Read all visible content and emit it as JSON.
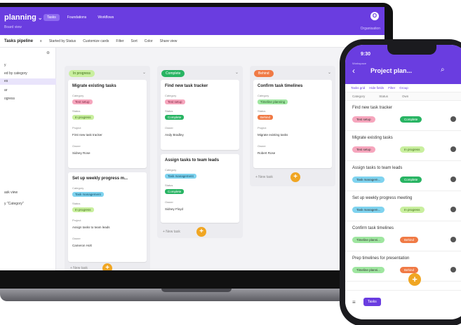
{
  "app": {
    "title": "planning",
    "title_caret": "⌄",
    "subtitle": "Board view",
    "nav": [
      "Tasks",
      "Foundations",
      "Workflows"
    ],
    "avatar_initial": "O",
    "top_right_label": "Organisation"
  },
  "toolbar": {
    "view": "Tasks pipeline",
    "items": [
      "Started by Status",
      "Customize cards",
      "Filter",
      "Sort",
      "Color",
      "Share view"
    ]
  },
  "sidebar": {
    "items": [
      "y",
      "ed by category",
      "es",
      "ar",
      "ogress",
      "ask view",
      "y \"Category\""
    ],
    "selected_index": 2
  },
  "columns": [
    {
      "status": "In progress",
      "color": "#c9ef9f",
      "text_color": "#3a6b12",
      "add_label": "+ New task",
      "cards": [
        {
          "title": "Migrate existing tasks",
          "category_label": "Category",
          "category": "Test setup",
          "status_label": "Status",
          "status": "In progress",
          "desc_label": "Project",
          "desc": "First new task tracker",
          "owner_label": "Owner",
          "owner": "Sidney Rose"
        },
        {
          "title": "Set up weekly progress m...",
          "category_label": "Category",
          "category": "Task management",
          "status_label": "Status",
          "status": "In progress",
          "desc_label": "Project",
          "desc": "Assign tasks to team leads",
          "owner_label": "Owner",
          "owner": "Cameron Holt"
        }
      ]
    },
    {
      "status": "Complete",
      "color": "#28b463",
      "text_color": "#ffffff",
      "add_label": "+ New task",
      "cards": [
        {
          "title": "Find new task tracker",
          "category_label": "Category",
          "category": "Test setup",
          "status_label": "Status",
          "status": "Complete",
          "owner_label": "Owner",
          "owner": "Andy Bradley"
        },
        {
          "title": "Assign tasks to team leads",
          "category_label": "Category",
          "category": "Task management",
          "status_label": "Status",
          "status": "Complete",
          "owner_label": "Owner",
          "owner": "Sidney Floyd"
        }
      ]
    },
    {
      "status": "Behind",
      "color": "#f07a45",
      "text_color": "#ffffff",
      "add_label": "+ New task",
      "cards": [
        {
          "title": "Confirm task timelines",
          "category_label": "Category",
          "category": "Timeline planning",
          "status_label": "Status",
          "status": "Behind",
          "desc_label": "Project",
          "desc": "Migrate existing tasks",
          "owner_label": "Owner",
          "owner": "Robert Rose"
        }
      ]
    }
  ],
  "phone": {
    "time": "9:30",
    "subtitle": "Workspace",
    "title": "Project plan...",
    "toolbar": [
      "Tasks grid",
      "Hide fields",
      "Filter",
      "Group"
    ],
    "columns": [
      "Category",
      "Status",
      "Own"
    ],
    "rows": [
      {
        "title": "Find new task tracker",
        "category": "Test setup",
        "status": "Complete",
        "cat_color": "#f6a6bd",
        "st_color": "#28b463",
        "st_text": "#fff"
      },
      {
        "title": "Migrate existing tasks",
        "category": "Test setup",
        "status": "In progress",
        "cat_color": "#f6a6bd",
        "st_color": "#c9ef9f",
        "st_text": "#3a6b12"
      },
      {
        "title": "Assign tasks to team leads",
        "category": "Task managem...",
        "status": "Complete",
        "cat_color": "#7fd3ef",
        "st_color": "#28b463",
        "st_text": "#fff"
      },
      {
        "title": "Set up weekly progress meeting",
        "category": "Task managem...",
        "status": "In progress",
        "cat_color": "#7fd3ef",
        "st_color": "#c9ef9f",
        "st_text": "#3a6b12"
      },
      {
        "title": "Confirm task timelines",
        "category": "Timeline planni...",
        "status": "Behind",
        "cat_color": "#9fe6a0",
        "st_color": "#f07a45",
        "st_text": "#fff"
      },
      {
        "title": "Prep timelines for presentation",
        "category": "Timeline planni...",
        "status": "Behind",
        "cat_color": "#9fe6a0",
        "st_color": "#f07a45",
        "st_text": "#fff"
      }
    ],
    "bottom_tab": "Tasks"
  },
  "colors": {
    "brand": "#6a3de0",
    "accent": "#f0a623"
  }
}
